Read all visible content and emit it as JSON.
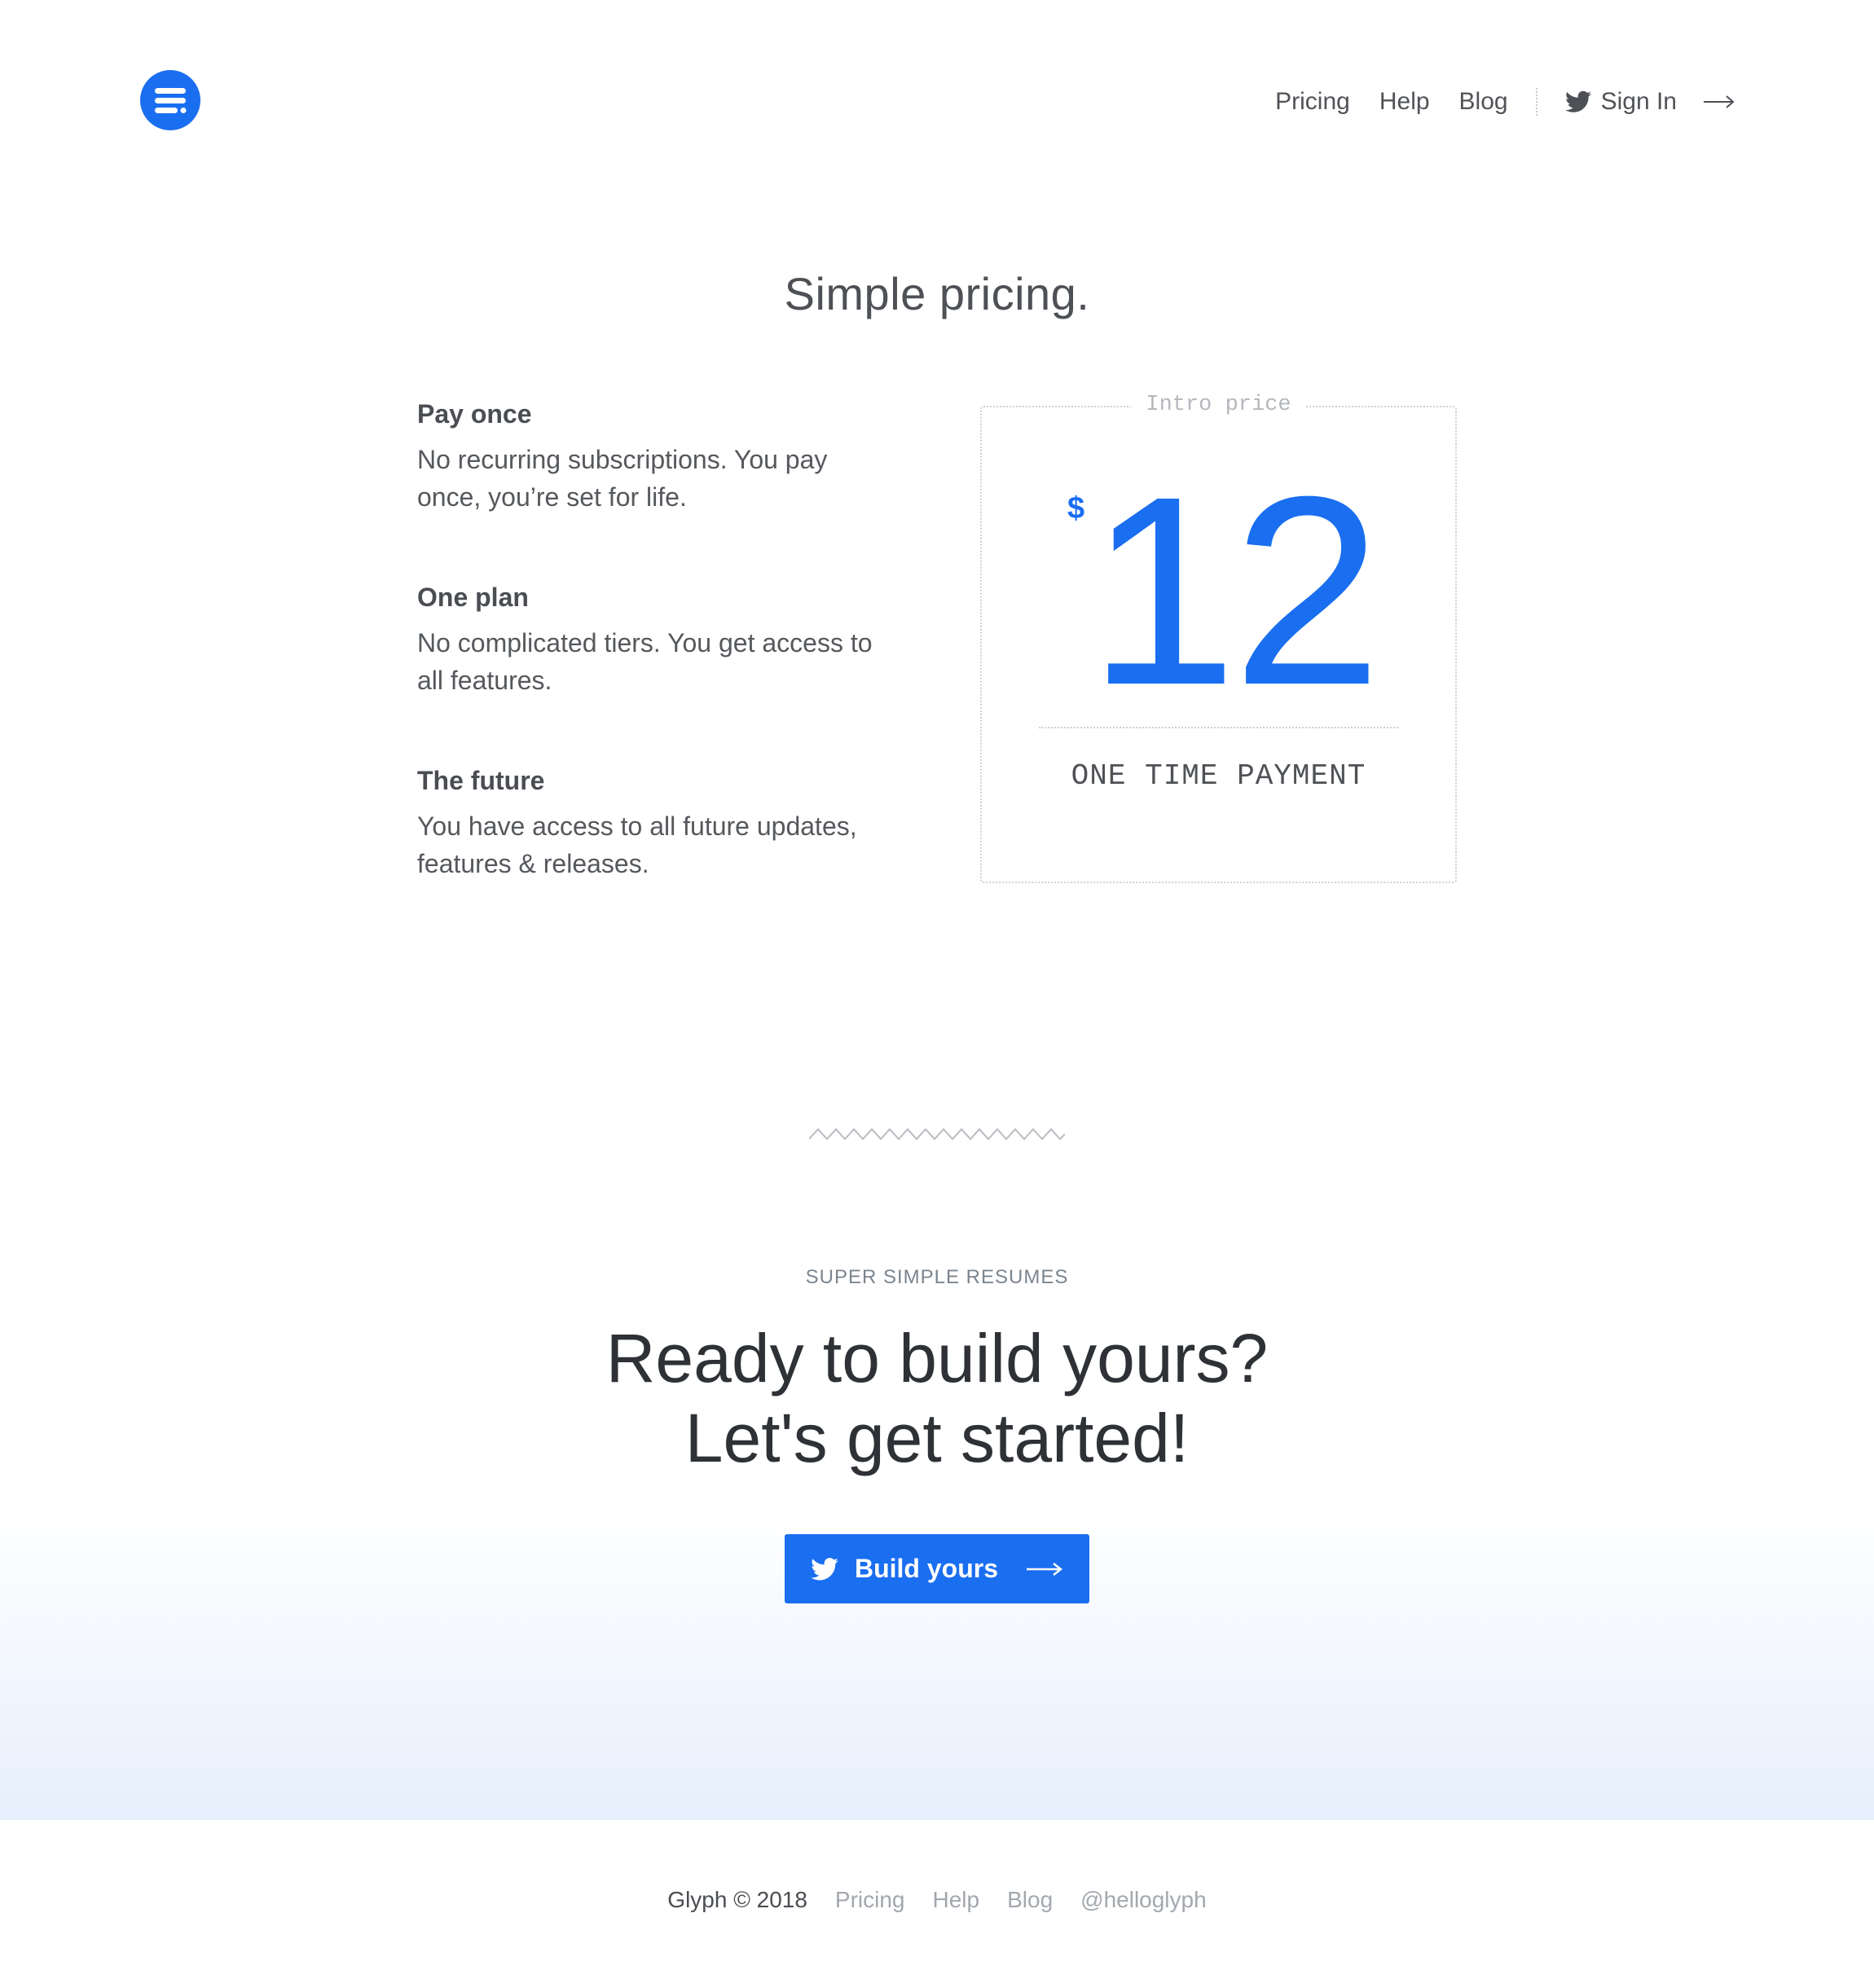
{
  "brand": {
    "logo_icon": "glyph-logo-icon",
    "accent_color": "#1a6ef0"
  },
  "nav": {
    "links": [
      "Pricing",
      "Help",
      "Blog"
    ],
    "signin_label": "Sign In",
    "signin_icon": "twitter-icon",
    "arrow_icon": "arrow-right-icon"
  },
  "pricing": {
    "title": "Simple pricing.",
    "features": [
      {
        "heading": "Pay once",
        "text": "No recurring subscriptions. You pay once, you’re set for life."
      },
      {
        "heading": "One plan",
        "text": "No complicated tiers. You get access to all features."
      },
      {
        "heading": "The future",
        "text": "You have access to all future updates, features & releases."
      }
    ],
    "box": {
      "label": "Intro price",
      "currency": "$",
      "amount": "12",
      "payment_label": "ONE TIME PAYMENT"
    }
  },
  "cta": {
    "eyebrow": "SUPER SIMPLE RESUMES",
    "heading_line1": "Ready to build yours?",
    "heading_line2": "Let's get started!",
    "button_label": "Build yours",
    "button_icon": "twitter-icon"
  },
  "footer": {
    "copyright": "Glyph © 2018",
    "links": [
      "Pricing",
      "Help",
      "Blog",
      "@helloglyph"
    ]
  }
}
